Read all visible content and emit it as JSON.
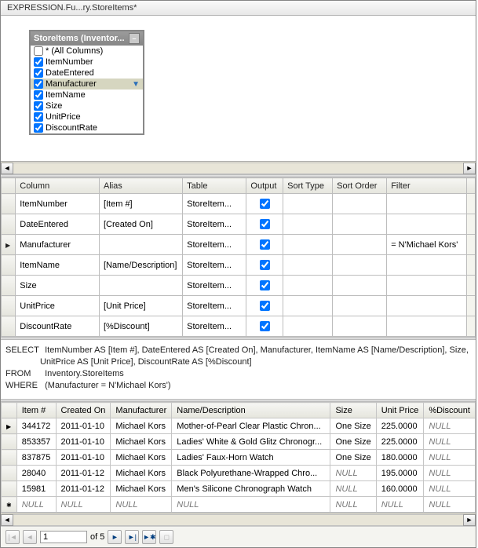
{
  "tabTitle": "EXPRESSION.Fu...ry.StoreItems*",
  "tableBox": {
    "title": "StoreItems (Inventor...",
    "columns": [
      {
        "label": "* (All Columns)",
        "checked": false,
        "filtered": false
      },
      {
        "label": "ItemNumber",
        "checked": true,
        "filtered": false
      },
      {
        "label": "DateEntered",
        "checked": true,
        "filtered": false
      },
      {
        "label": "Manufacturer",
        "checked": true,
        "filtered": true
      },
      {
        "label": "ItemName",
        "checked": true,
        "filtered": false
      },
      {
        "label": "Size",
        "checked": true,
        "filtered": false
      },
      {
        "label": "UnitPrice",
        "checked": true,
        "filtered": false
      },
      {
        "label": "DiscountRate",
        "checked": true,
        "filtered": false
      }
    ]
  },
  "criteria": {
    "headers": [
      "Column",
      "Alias",
      "Table",
      "Output",
      "Sort Type",
      "Sort Order",
      "Filter"
    ],
    "rows": [
      {
        "current": false,
        "col": "ItemNumber",
        "alias": "[Item #]",
        "table": "StoreItem...",
        "output": true,
        "sortType": "",
        "sortOrder": "",
        "filter": ""
      },
      {
        "current": false,
        "col": "DateEntered",
        "alias": "[Created On]",
        "table": "StoreItem...",
        "output": true,
        "sortType": "",
        "sortOrder": "",
        "filter": ""
      },
      {
        "current": true,
        "col": "Manufacturer",
        "alias": "",
        "table": "StoreItem...",
        "output": true,
        "sortType": "",
        "sortOrder": "",
        "filter": "= N'Michael Kors'"
      },
      {
        "current": false,
        "col": "ItemName",
        "alias": "[Name/Description]",
        "table": "StoreItem...",
        "output": true,
        "sortType": "",
        "sortOrder": "",
        "filter": ""
      },
      {
        "current": false,
        "col": "Size",
        "alias": "",
        "table": "StoreItem...",
        "output": true,
        "sortType": "",
        "sortOrder": "",
        "filter": ""
      },
      {
        "current": false,
        "col": "UnitPrice",
        "alias": "[Unit Price]",
        "table": "StoreItem...",
        "output": true,
        "sortType": "",
        "sortOrder": "",
        "filter": ""
      },
      {
        "current": false,
        "col": "DiscountRate",
        "alias": "[%Discount]",
        "table": "StoreItem...",
        "output": true,
        "sortType": "",
        "sortOrder": "",
        "filter": ""
      }
    ]
  },
  "sql": {
    "select": "SELECT",
    "selectBody": "ItemNumber AS [Item #], DateEntered AS [Created On], Manufacturer, ItemName AS [Name/Description], Size, UnitPrice AS [Unit Price], DiscountRate AS [%Discount]",
    "from": "FROM",
    "fromBody": "Inventory.StoreItems",
    "where": "WHERE",
    "whereBody": "(Manufacturer = N'Michael Kors')"
  },
  "results": {
    "headers": [
      "Item #",
      "Created On",
      "Manufacturer",
      "Name/Description",
      "Size",
      "Unit Price",
      "%Discount"
    ],
    "rows": [
      {
        "marker": "arrow",
        "cells": [
          "344172",
          "2011-01-10",
          "Michael Kors",
          "Mother-of-Pearl Clear Plastic Chron...",
          "One Size",
          "225.0000",
          "NULL"
        ]
      },
      {
        "marker": "",
        "cells": [
          "853357",
          "2011-01-10",
          "Michael Kors",
          "Ladies' White & Gold Glitz Chronogr...",
          "One Size",
          "225.0000",
          "NULL"
        ]
      },
      {
        "marker": "",
        "cells": [
          "837875",
          "2011-01-10",
          "Michael Kors",
          "Ladies' Faux-Horn Watch",
          "One Size",
          "180.0000",
          "NULL"
        ]
      },
      {
        "marker": "",
        "cells": [
          "28040",
          "2011-01-12",
          "Michael Kors",
          "Black Polyurethane-Wrapped Chro...",
          "NULL",
          "195.0000",
          "NULL"
        ]
      },
      {
        "marker": "",
        "cells": [
          "15981",
          "2011-01-12",
          "Michael Kors",
          "Men's Silicone Chronograph Watch",
          "NULL",
          "160.0000",
          "NULL"
        ]
      },
      {
        "marker": "star",
        "cells": [
          "NULL",
          "NULL",
          "NULL",
          "NULL",
          "NULL",
          "NULL",
          "NULL"
        ]
      }
    ]
  },
  "pager": {
    "pos": "1",
    "total": "of 5"
  }
}
